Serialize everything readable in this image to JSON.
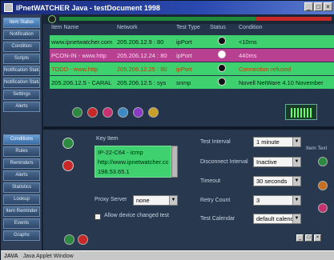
{
  "window": {
    "title": "IPnetWATCHER Java - testDocument 1998",
    "buttons": [
      "_",
      "□",
      "×"
    ]
  },
  "sidebar": {
    "top_items": [
      "Item Status",
      "Notification",
      "Condition",
      "Scripts",
      "Notification Status",
      "Notification Status",
      "Settings",
      "Alerts"
    ],
    "bottom_items": [
      "Conditions",
      "Rules",
      "Reminders",
      "Alerts",
      "Statistics",
      "Lookup",
      "Item Reminder",
      "Events",
      "Graphs"
    ]
  },
  "table": {
    "headers": [
      "Item Name",
      "Network",
      "Test Type",
      "Status",
      "Condition"
    ],
    "rows": [
      {
        "name": "www.ipnetwatcher.com",
        "network": "205.206.12.9 : 80",
        "type": "ipPort",
        "condition": "<10ms"
      },
      {
        "name": "PCON-IN - www.http",
        "network": "205.206.12.24 : 80",
        "type": "ipPort",
        "condition": "440ms"
      },
      {
        "name": "TODD - www.http",
        "network": "205.206.12.25 : 80",
        "type": "ipPort",
        "condition": "Connection refused"
      },
      {
        "name": "205.206.12.5 - CARAL",
        "network": "205.206.12.5 : sys",
        "type": "snmp",
        "condition": "Novell NetWare 4.10 November"
      }
    ]
  },
  "details": {
    "alias_label": "Key Item",
    "alias_lines": [
      "IP-22-C64 - icmp",
      "http://www.ipnetwatcher.com/ti",
      "198.53.65.1"
    ],
    "proxy_label": "Proxy Server",
    "proxy_value": "none",
    "checkbox_label": "Allow device changed test",
    "test_interval_label": "Test Interval",
    "test_interval_value": "1 minute",
    "disconnect_label": "Disconnect Interval",
    "disconnect_value": "Inactive",
    "timeout_label": "Timeout",
    "timeout_value": "30 seconds",
    "retry_label": "Retry Count",
    "retry_value": "3",
    "calendar_label": "Test Calendar",
    "calendar_value": "default calend",
    "right_label": "Item Text"
  },
  "statusbar": {
    "java_label": "JAVA",
    "text": "Java Applet Window"
  },
  "colors": {
    "row_green": "#3fd070",
    "row_magenta": "#b84090",
    "status_green": "#1f8a3a",
    "status_red": "#c82828"
  }
}
